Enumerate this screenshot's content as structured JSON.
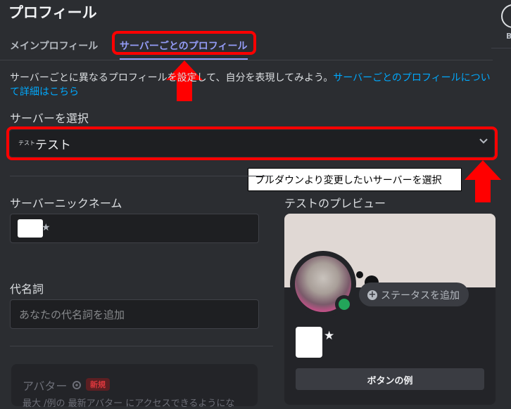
{
  "header": {
    "title": "プロフィール",
    "top_right_letter": "B"
  },
  "tabs": [
    {
      "label": "メインプロフィール"
    },
    {
      "label": "サーバーごとのプロフィール",
      "active": true
    }
  ],
  "description": {
    "text": "サーバーごとに異なるプロフィールを設定して、自分を表現してみよう。",
    "link_text": "サーバーごとのプロフィールについて詳細はこちら"
  },
  "server_select": {
    "label": "サーバーを選択",
    "icon_text": "テスト",
    "value": "テスト",
    "chevron": "chevron-down-icon"
  },
  "annotation": {
    "text": "プルダウンより変更したいサーバーを選択"
  },
  "nickname": {
    "label": "サーバーニックネーム",
    "suffix": "★"
  },
  "pronouns": {
    "label": "代名詞",
    "placeholder": "あなたの代名詞を追加"
  },
  "avatar_section": {
    "label": "アバター",
    "badge": "新規",
    "partial_text": "最大 /例の 最新アバター にアクセスできるようにな"
  },
  "preview": {
    "title": "テストのプレビュー",
    "status_button": "ステータスを追加",
    "name_suffix": "★",
    "sample_button": "ボタンの例"
  },
  "colors": {
    "background": "#2b2d31",
    "accent": "#949cf7",
    "link": "#00a8fc",
    "annotation_red": "#ff0000",
    "online": "#23a55a"
  }
}
